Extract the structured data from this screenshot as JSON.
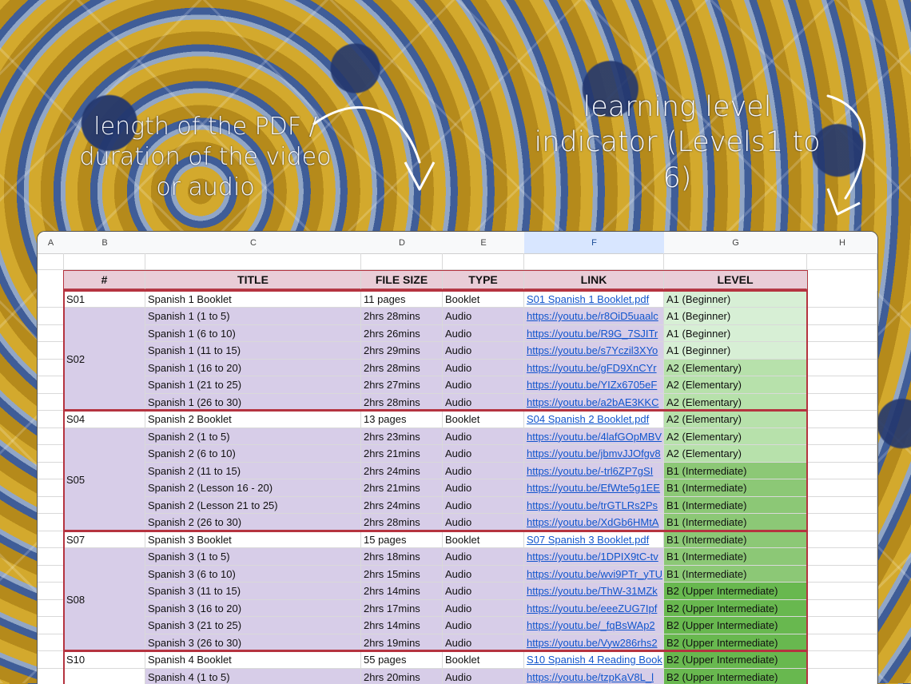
{
  "annotations": {
    "left": "length of the PDF / duration of the video or audio",
    "right": "learning level indicator (Levels1 to 6)"
  },
  "columns": [
    "A",
    "B",
    "C",
    "D",
    "E",
    "F",
    "G",
    "H"
  ],
  "headers": [
    "#",
    "TITLE",
    "FILE SIZE",
    "TYPE",
    "LINK",
    "LEVEL"
  ],
  "rows": [
    {
      "id": "S01",
      "title": "Spanish 1 Booklet",
      "size": "11 pages",
      "type": "Booklet",
      "link": "S01 Spanish 1 Booklet.pdf",
      "level": "A1 (Beginner)",
      "lv": "a1",
      "lav": false
    },
    {
      "id": "",
      "title": "Spanish 1 (1 to 5)",
      "size": "2hrs 28mins",
      "type": "Audio",
      "link": "https://youtu.be/r8OiD5uaalc",
      "level": "A1 (Beginner)",
      "lv": "a1",
      "lav": true
    },
    {
      "id": "",
      "title": "Spanish 1 (6 to 10)",
      "size": "2hrs 26mins",
      "type": "Audio",
      "link": "https://youtu.be/R9G_7SJITr",
      "level": "A1 (Beginner)",
      "lv": "a1",
      "lav": true
    },
    {
      "id": "",
      "title": "Spanish 1 (11 to 15)",
      "size": "2hrs 29mins",
      "type": "Audio",
      "link": "https://youtu.be/s7Yczil3XYo",
      "level": "A1 (Beginner)",
      "lv": "a1",
      "lav": true
    },
    {
      "id": "",
      "title": "Spanish 1 (16 to 20)",
      "size": "2hrs 28mins",
      "type": "Audio",
      "link": "https://youtu.be/gFD9XnCYr",
      "level": "A2 (Elementary)",
      "lv": "a2",
      "lav": true
    },
    {
      "id": "",
      "title": "Spanish 1 (21 to 25)",
      "size": "2hrs 27mins",
      "type": "Audio",
      "link": "https://youtu.be/YIZx6705eF",
      "level": "A2 (Elementary)",
      "lv": "a2",
      "lav": true
    },
    {
      "id": "",
      "title": "Spanish 1 (26 to 30)",
      "size": "2hrs 28mins",
      "type": "Audio",
      "link": "https://youtu.be/a2bAE3KKC",
      "level": "A2 (Elementary)",
      "lv": "a2",
      "lav": true
    },
    {
      "id": "S04",
      "title": "Spanish 2 Booklet",
      "size": "13 pages",
      "type": "Booklet",
      "link": "S04 Spanish 2 Booklet.pdf",
      "level": "A2 (Elementary)",
      "lv": "a2",
      "lav": false
    },
    {
      "id": "",
      "title": "Spanish 2 (1 to 5)",
      "size": "2hrs 23mins",
      "type": "Audio",
      "link": "https://youtu.be/4lafGOpMBV",
      "level": "A2 (Elementary)",
      "lv": "a2",
      "lav": true
    },
    {
      "id": "",
      "title": "Spanish 2 (6 to 10)",
      "size": "2hrs 21mins",
      "type": "Audio",
      "link": "https://youtu.be/jbmvJJOfgv8",
      "level": "A2 (Elementary)",
      "lv": "a2",
      "lav": true
    },
    {
      "id": "",
      "title": "Spanish 2 (11 to 15)",
      "size": "2hrs 24mins",
      "type": "Audio",
      "link": "https://youtu.be/-trl6ZP7gSI",
      "level": "B1 (Intermediate)",
      "lv": "b1",
      "lav": true
    },
    {
      "id": "",
      "title": "Spanish 2 (Lesson 16 - 20)",
      "size": "2hrs 21mins",
      "type": "Audio",
      "link": "https://youtu.be/EfWte5g1EE",
      "level": "B1 (Intermediate)",
      "lv": "b1",
      "lav": true
    },
    {
      "id": "",
      "title": "Spanish 2 (Lesson 21 to 25)",
      "size": "2hrs 24mins",
      "type": "Audio",
      "link": "https://youtu.be/trGTLRs2Ps",
      "level": "B1 (Intermediate)",
      "lv": "b1",
      "lav": true
    },
    {
      "id": "",
      "title": "Spanish 2 (26 to 30)",
      "size": "2hrs 28mins",
      "type": "Audio",
      "link": "https://youtu.be/XdGb6HMtA",
      "level": "B1 (Intermediate)",
      "lv": "b1",
      "lav": true
    },
    {
      "id": "S07",
      "title": "Spanish 3 Booklet",
      "size": "15 pages",
      "type": "Booklet",
      "link": "S07 Spanish 3 Booklet.pdf",
      "level": "B1 (Intermediate)",
      "lv": "b1",
      "lav": false
    },
    {
      "id": "",
      "title": "Spanish 3 (1 to 5)",
      "size": "2hrs 18mins",
      "type": "Audio",
      "link": "https://youtu.be/1DPIX9tC-tv",
      "level": "B1 (Intermediate)",
      "lv": "b1",
      "lav": true
    },
    {
      "id": "",
      "title": "Spanish 3 (6 to 10)",
      "size": "2hrs 15mins",
      "type": "Audio",
      "link": "https://youtu.be/wvi9PTr_yTU",
      "level": "B1 (Intermediate)",
      "lv": "b1",
      "lav": true
    },
    {
      "id": "",
      "title": "Spanish 3 (11 to 15)",
      "size": "2hrs 14mins",
      "type": "Audio",
      "link": "https://youtu.be/ThW-31MZk",
      "level": "B2 (Upper Intermediate)",
      "lv": "b2",
      "lav": true
    },
    {
      "id": "",
      "title": "Spanish 3 (16 to 20)",
      "size": "2hrs 17mins",
      "type": "Audio",
      "link": "https://youtu.be/eeeZUG7Ipf",
      "level": "B2 (Upper Intermediate)",
      "lv": "b2",
      "lav": true
    },
    {
      "id": "",
      "title": "Spanish 3 (21 to 25)",
      "size": "2hrs 14mins",
      "type": "Audio",
      "link": "https://youtu.be/_fqBsWAp2",
      "level": "B2 (Upper Intermediate)",
      "lv": "b2",
      "lav": true
    },
    {
      "id": "",
      "title": "Spanish 3 (26 to 30)",
      "size": "2hrs 19mins",
      "type": "Audio",
      "link": "https://youtu.be/Vyw286rhs2",
      "level": "B2 (Upper Intermediate)",
      "lv": "b2",
      "lav": true
    },
    {
      "id": "S10",
      "title": "Spanish 4 Booklet",
      "size": "55 pages",
      "type": "Booklet",
      "link": "S10 Spanish 4 Reading Book",
      "level": "B2 (Upper Intermediate)",
      "lv": "b2",
      "lav": false
    },
    {
      "id": "",
      "title": "Spanish 4 (1 to 5)",
      "size": "2hrs 20mins",
      "type": "Audio",
      "link": "https://youtu.be/tzpKaV8L_l",
      "level": "B2 (Upper Intermediate)",
      "lv": "b2",
      "lav": true
    }
  ],
  "groups": [
    {
      "label": "S02",
      "start": 1,
      "end": 6
    },
    {
      "label": "S05",
      "start": 8,
      "end": 13
    },
    {
      "label": "S08",
      "start": 15,
      "end": 20
    }
  ]
}
